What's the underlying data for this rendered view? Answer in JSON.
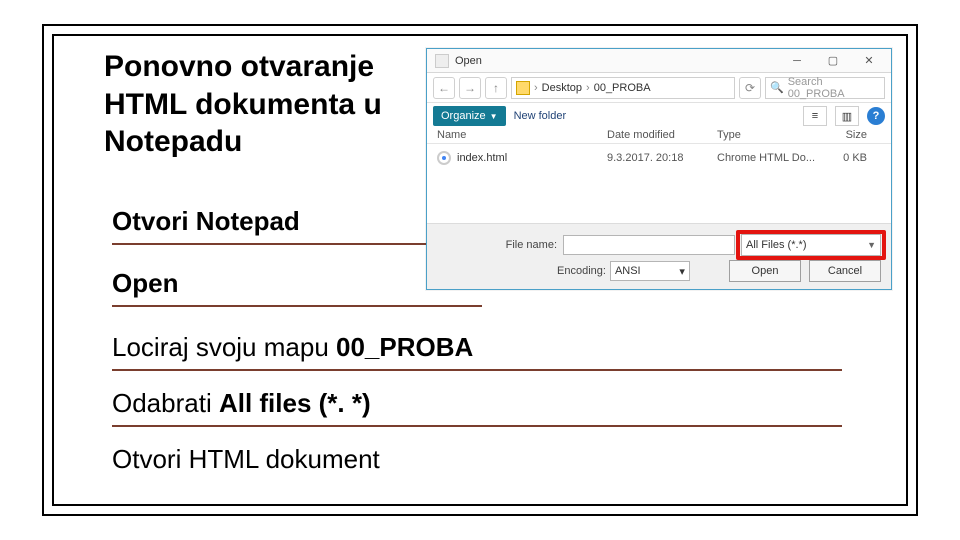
{
  "slide": {
    "title": "Ponovno otvaranje HTML dokumenta u Notepadu",
    "bullets": {
      "b1": "Otvori Notepad",
      "b2": "Open",
      "b3_pre": "Lociraj svoju mapu ",
      "b3_bold": "00_PROBA",
      "b4_pre": "Odabrati ",
      "b4_bold": "All files (*. *)",
      "b5": "Otvori HTML dokument"
    }
  },
  "dialog": {
    "title": "Open",
    "breadcrumb": {
      "p1": "Desktop",
      "p2": "00_PROBA"
    },
    "search_placeholder": "Search 00_PROBA",
    "organize": "Organize",
    "newfolder": "New folder",
    "columns": {
      "name": "Name",
      "date": "Date modified",
      "type": "Type",
      "size": "Size"
    },
    "file": {
      "name": "index.html",
      "date": "9.3.2017. 20:18",
      "type": "Chrome HTML Do...",
      "size": "0 KB"
    },
    "filename_label": "File name:",
    "filetype": "All Files  (*.*)",
    "encoding_label": "Encoding:",
    "encoding_value": "ANSI",
    "open_btn": "Open",
    "cancel_btn": "Cancel"
  }
}
